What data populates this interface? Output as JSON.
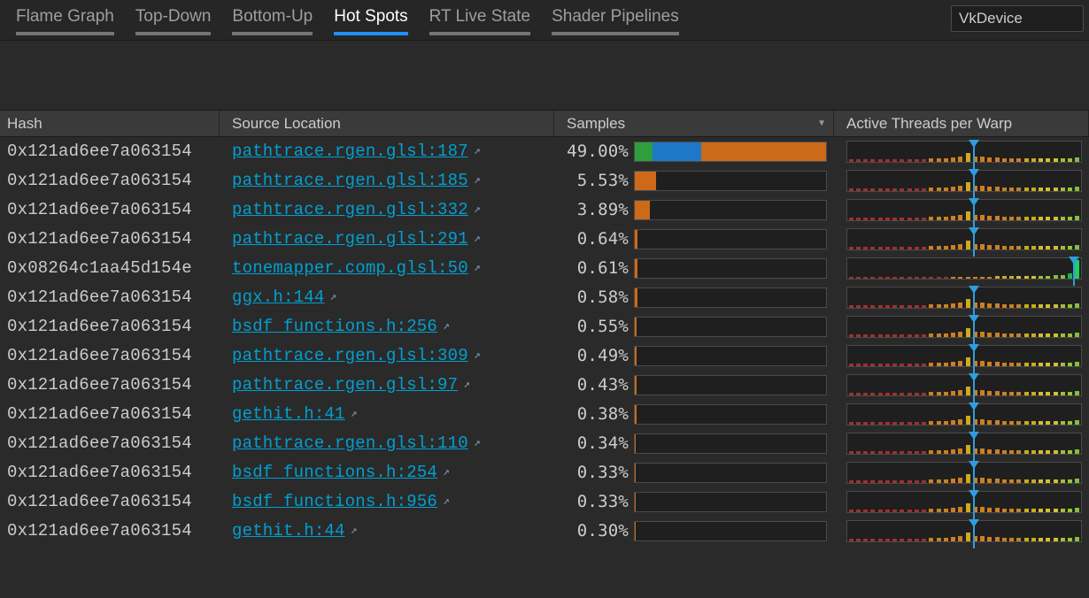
{
  "tabs": [
    "Flame Graph",
    "Top-Down",
    "Bottom-Up",
    "Hot Spots",
    "RT Live State",
    "Shader Pipelines"
  ],
  "active_tab": 3,
  "device_selector": "VkDevice",
  "columns": {
    "hash": "Hash",
    "src": "Source Location",
    "samples": "Samples",
    "warp": "Active Threads per Warp"
  },
  "sort_column": "samples",
  "sort_dir": "desc",
  "max_pct": 49.0,
  "segment_colors": [
    "#2e9e3e",
    "#1e78c8",
    "#cc6a1a"
  ],
  "rows": [
    {
      "hash": "0x121ad6ee7a063154",
      "src": "pathtrace.rgen.glsl:187",
      "pct": "49.00%",
      "segments": [
        4.5,
        12.5,
        32.0
      ],
      "marker": 0.54,
      "warp": {
        "pattern": "std"
      }
    },
    {
      "hash": "0x121ad6ee7a063154",
      "src": "pathtrace.rgen.glsl:185",
      "pct": "5.53%",
      "segments": [
        0.0,
        0.0,
        5.53
      ],
      "marker": 0.54,
      "warp": {
        "pattern": "std"
      }
    },
    {
      "hash": "0x121ad6ee7a063154",
      "src": "pathtrace.rgen.glsl:332",
      "pct": "3.89%",
      "segments": [
        0.0,
        0.0,
        3.89
      ],
      "marker": 0.54,
      "warp": {
        "pattern": "std"
      }
    },
    {
      "hash": "0x121ad6ee7a063154",
      "src": "pathtrace.rgen.glsl:291",
      "pct": "0.64%",
      "segments": [
        0.0,
        0.0,
        0.64
      ],
      "marker": 0.54,
      "warp": {
        "pattern": "std"
      }
    },
    {
      "hash": "0x08264c1aa45d154e",
      "src": "tonemapper.comp.glsl:50",
      "pct": "0.61%",
      "segments": [
        0.0,
        0.0,
        0.61
      ],
      "marker": 0.97,
      "warp": {
        "pattern": "high"
      }
    },
    {
      "hash": "0x121ad6ee7a063154",
      "src": "ggx.h:144",
      "pct": "0.58%",
      "segments": [
        0.0,
        0.0,
        0.58
      ],
      "marker": 0.54,
      "warp": {
        "pattern": "std"
      }
    },
    {
      "hash": "0x121ad6ee7a063154",
      "src": "bsdf_functions.h:256",
      "pct": "0.55%",
      "segments": [
        0.0,
        0.0,
        0.55
      ],
      "marker": 0.54,
      "warp": {
        "pattern": "std"
      }
    },
    {
      "hash": "0x121ad6ee7a063154",
      "src": "pathtrace.rgen.glsl:309",
      "pct": "0.49%",
      "segments": [
        0.0,
        0.0,
        0.49
      ],
      "marker": 0.54,
      "warp": {
        "pattern": "std"
      }
    },
    {
      "hash": "0x121ad6ee7a063154",
      "src": "pathtrace.rgen.glsl:97",
      "pct": "0.43%",
      "segments": [
        0.0,
        0.0,
        0.43
      ],
      "marker": 0.54,
      "warp": {
        "pattern": "std"
      }
    },
    {
      "hash": "0x121ad6ee7a063154",
      "src": "gethit.h:41",
      "pct": "0.38%",
      "segments": [
        0.0,
        0.0,
        0.38
      ],
      "marker": 0.54,
      "warp": {
        "pattern": "std"
      }
    },
    {
      "hash": "0x121ad6ee7a063154",
      "src": "pathtrace.rgen.glsl:110",
      "pct": "0.34%",
      "segments": [
        0.0,
        0.0,
        0.34
      ],
      "marker": 0.54,
      "warp": {
        "pattern": "std"
      }
    },
    {
      "hash": "0x121ad6ee7a063154",
      "src": "bsdf_functions.h:254",
      "pct": "0.33%",
      "segments": [
        0.0,
        0.0,
        0.33
      ],
      "marker": 0.54,
      "warp": {
        "pattern": "std"
      }
    },
    {
      "hash": "0x121ad6ee7a063154",
      "src": "bsdf_functions.h:956",
      "pct": "0.33%",
      "segments": [
        0.0,
        0.0,
        0.33
      ],
      "marker": 0.54,
      "warp": {
        "pattern": "std"
      }
    },
    {
      "hash": "0x121ad6ee7a063154",
      "src": "gethit.h:44",
      "pct": "0.30%",
      "segments": [
        0.0,
        0.0,
        0.3
      ],
      "marker": 0.54,
      "warp": {
        "pattern": "std"
      }
    }
  ],
  "warp_patterns": {
    "std": {
      "buckets": [
        {
          "h": 3,
          "c": "#a03030"
        },
        {
          "h": 3,
          "c": "#a03030"
        },
        {
          "h": 3,
          "c": "#a03030"
        },
        {
          "h": 3,
          "c": "#a03030"
        },
        {
          "h": 3,
          "c": "#a03030"
        },
        {
          "h": 3,
          "c": "#a03030"
        },
        {
          "h": 3,
          "c": "#a03030"
        },
        {
          "h": 3,
          "c": "#a03030"
        },
        {
          "h": 3,
          "c": "#a03030"
        },
        {
          "h": 3,
          "c": "#a03030"
        },
        {
          "h": 3,
          "c": "#a03030"
        },
        {
          "h": 4,
          "c": "#cc8020"
        },
        {
          "h": 4,
          "c": "#cc8020"
        },
        {
          "h": 4,
          "c": "#cc8020"
        },
        {
          "h": 5,
          "c": "#cc8020"
        },
        {
          "h": 6,
          "c": "#cc8020"
        },
        {
          "h": 10,
          "c": "#ccaa20"
        },
        {
          "h": 6,
          "c": "#cc8020"
        },
        {
          "h": 6,
          "c": "#cc8020"
        },
        {
          "h": 5,
          "c": "#cc8020"
        },
        {
          "h": 5,
          "c": "#cc8020"
        },
        {
          "h": 4,
          "c": "#cc8020"
        },
        {
          "h": 4,
          "c": "#cc8020"
        },
        {
          "h": 4,
          "c": "#cc8020"
        },
        {
          "h": 4,
          "c": "#ccaa20"
        },
        {
          "h": 4,
          "c": "#ccaa20"
        },
        {
          "h": 4,
          "c": "#d0c030"
        },
        {
          "h": 4,
          "c": "#d0c030"
        },
        {
          "h": 4,
          "c": "#d0c030"
        },
        {
          "h": 4,
          "c": "#a0c030"
        },
        {
          "h": 4,
          "c": "#a0c030"
        },
        {
          "h": 5,
          "c": "#80c040"
        }
      ]
    },
    "high": {
      "buckets": [
        {
          "h": 2,
          "c": "#a03030"
        },
        {
          "h": 2,
          "c": "#a03030"
        },
        {
          "h": 2,
          "c": "#a03030"
        },
        {
          "h": 2,
          "c": "#a03030"
        },
        {
          "h": 2,
          "c": "#a03030"
        },
        {
          "h": 2,
          "c": "#a03030"
        },
        {
          "h": 2,
          "c": "#a03030"
        },
        {
          "h": 2,
          "c": "#a03030"
        },
        {
          "h": 2,
          "c": "#a03030"
        },
        {
          "h": 2,
          "c": "#a03030"
        },
        {
          "h": 2,
          "c": "#a03030"
        },
        {
          "h": 2,
          "c": "#a03030"
        },
        {
          "h": 2,
          "c": "#a03030"
        },
        {
          "h": 2,
          "c": "#a03030"
        },
        {
          "h": 2,
          "c": "#cc8020"
        },
        {
          "h": 2,
          "c": "#cc8020"
        },
        {
          "h": 2,
          "c": "#cc8020"
        },
        {
          "h": 2,
          "c": "#cc8020"
        },
        {
          "h": 2,
          "c": "#cc8020"
        },
        {
          "h": 2,
          "c": "#cc8020"
        },
        {
          "h": 3,
          "c": "#ccaa20"
        },
        {
          "h": 3,
          "c": "#ccaa20"
        },
        {
          "h": 3,
          "c": "#ccaa20"
        },
        {
          "h": 3,
          "c": "#d0c030"
        },
        {
          "h": 3,
          "c": "#d0c030"
        },
        {
          "h": 3,
          "c": "#d0c030"
        },
        {
          "h": 3,
          "c": "#a0c030"
        },
        {
          "h": 3,
          "c": "#a0c030"
        },
        {
          "h": 4,
          "c": "#80c040"
        },
        {
          "h": 4,
          "c": "#80c040"
        },
        {
          "h": 6,
          "c": "#20b050"
        },
        {
          "h": 21,
          "c": "#20d060"
        }
      ]
    }
  }
}
